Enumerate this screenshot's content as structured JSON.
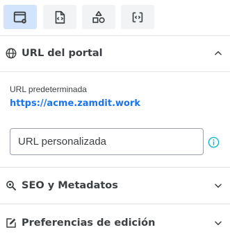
{
  "toolbar": {
    "buttons": [
      {
        "icon": "window-settings-icon",
        "active": true
      },
      {
        "icon": "code-file-icon",
        "active": false
      },
      {
        "icon": "shapes-icon",
        "active": false
      },
      {
        "icon": "code-brackets-icon",
        "active": false
      }
    ]
  },
  "sections": {
    "portal": {
      "title": "URL del portal",
      "icon": "globe-icon",
      "expanded": true
    },
    "seo": {
      "title": "SEO y Metadatos",
      "icon": "search-icon",
      "expanded": false
    },
    "editing": {
      "title": "Preferencias de edición",
      "icon": "edit-icon",
      "expanded": false
    }
  },
  "portal": {
    "default_url_label": "URL predeterminada",
    "default_url": "https://acme.zamdit.work",
    "custom_url_placeholder": "URL personalizada"
  },
  "colors": {
    "accent": "#1a73e8",
    "active_tab_bg": "#d2e3fc",
    "info_icon": "#12b5cb"
  }
}
